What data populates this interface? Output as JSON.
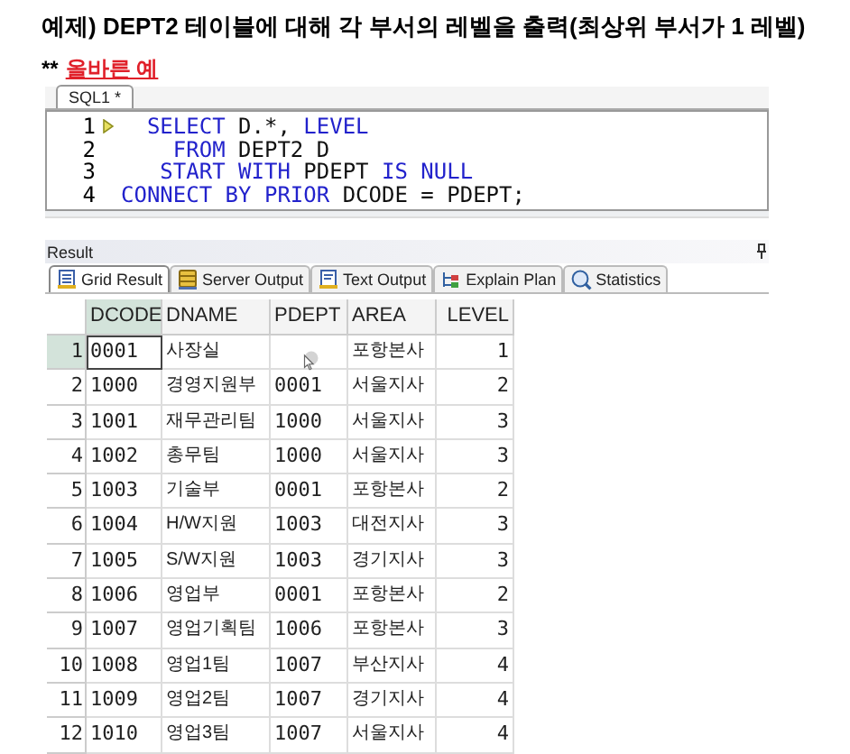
{
  "heading": "예제) DEPT2 테이블에 대해 각 부서의 레벨을 출력(최상위 부서가 1 레벨)",
  "subheading": {
    "prefix": "**",
    "link": "올바른 예"
  },
  "editor": {
    "tab": {
      "label": "SQL1 *",
      "selected": true
    },
    "lines": [
      {
        "number": "1",
        "current": true,
        "tokens": [
          {
            "kind": "keyword",
            "text": "  SELECT"
          },
          {
            "kind": "plain",
            "text": " D.*, "
          },
          {
            "kind": "keyword",
            "text": "LEVEL"
          }
        ]
      },
      {
        "number": "2",
        "current": false,
        "tokens": [
          {
            "kind": "keyword",
            "text": "    FROM"
          },
          {
            "kind": "plain",
            "text": " DEPT2 D"
          }
        ]
      },
      {
        "number": "3",
        "current": false,
        "tokens": [
          {
            "kind": "keyword",
            "text": "   START WITH"
          },
          {
            "kind": "plain",
            "text": " PDEPT "
          },
          {
            "kind": "keyword",
            "text": "IS NULL"
          }
        ]
      },
      {
        "number": "4",
        "current": false,
        "tokens": [
          {
            "kind": "keyword",
            "text": "CONNECT BY PRIOR"
          },
          {
            "kind": "plain",
            "text": " DCODE = PDEPT;"
          }
        ]
      }
    ]
  },
  "result": {
    "title": "Result",
    "tabs": [
      {
        "label": "Grid Result",
        "selected": true,
        "kind": "grid"
      },
      {
        "label": "Server Output",
        "selected": false,
        "kind": "server"
      },
      {
        "label": "Text Output",
        "selected": false,
        "kind": "text"
      },
      {
        "label": "Explain Plan",
        "selected": false,
        "kind": "plan"
      },
      {
        "label": "Statistics",
        "selected": false,
        "kind": "stats"
      }
    ],
    "columns": [
      {
        "label": "DCODE",
        "selected": true
      },
      {
        "label": "DNAME",
        "selected": false
      },
      {
        "label": "PDEPT",
        "selected": false
      },
      {
        "label": "AREA",
        "selected": false
      },
      {
        "label": "LEVEL",
        "selected": false
      }
    ],
    "rows": [
      {
        "number": "1",
        "selected": true,
        "cells": [
          "0001",
          "사장실",
          "",
          "포항본사",
          "1"
        ]
      },
      {
        "number": "2",
        "selected": false,
        "cells": [
          "1000",
          "경영지원부",
          "0001",
          "서울지사",
          "2"
        ]
      },
      {
        "number": "3",
        "selected": false,
        "cells": [
          "1001",
          "재무관리팀",
          "1000",
          "서울지사",
          "3"
        ]
      },
      {
        "number": "4",
        "selected": false,
        "cells": [
          "1002",
          "총무팀",
          "1000",
          "서울지사",
          "3"
        ]
      },
      {
        "number": "5",
        "selected": false,
        "cells": [
          "1003",
          "기술부",
          "0001",
          "포항본사",
          "2"
        ]
      },
      {
        "number": "6",
        "selected": false,
        "cells": [
          "1004",
          "H/W지원",
          "1003",
          "대전지사",
          "3"
        ]
      },
      {
        "number": "7",
        "selected": false,
        "cells": [
          "1005",
          "S/W지원",
          "1003",
          "경기지사",
          "3"
        ]
      },
      {
        "number": "8",
        "selected": false,
        "cells": [
          "1006",
          "영업부",
          "0001",
          "포항본사",
          "2"
        ]
      },
      {
        "number": "9",
        "selected": false,
        "cells": [
          "1007",
          "영업기획팀",
          "1006",
          "포항본사",
          "3"
        ]
      },
      {
        "number": "10",
        "selected": false,
        "cells": [
          "1008",
          "영업1팀",
          "1007",
          "부산지사",
          "4"
        ]
      },
      {
        "number": "11",
        "selected": false,
        "cells": [
          "1009",
          "영업2팀",
          "1007",
          "경기지사",
          "4"
        ]
      },
      {
        "number": "12",
        "selected": false,
        "cells": [
          "1010",
          "영업3팀",
          "1007",
          "서울지사",
          "4"
        ]
      }
    ]
  }
}
